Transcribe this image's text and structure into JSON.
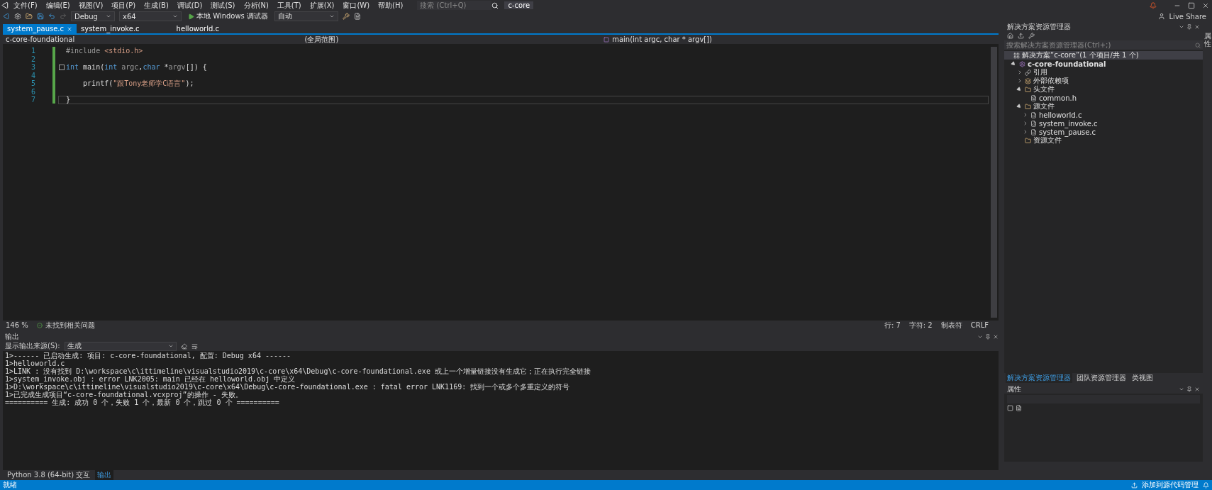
{
  "menu_bar": {
    "items": [
      "文件(F)",
      "编辑(E)",
      "视图(V)",
      "项目(P)",
      "生成(B)",
      "调试(D)",
      "测试(S)",
      "分析(N)",
      "工具(T)",
      "扩展(X)",
      "窗口(W)",
      "帮助(H)"
    ],
    "search": {
      "placeholder": "搜索 (Ctrl+Q)"
    },
    "solution_name": "c-core",
    "live_share": "Live Share"
  },
  "toolbar": {
    "configuration": "Debug",
    "platform": "x64",
    "debugger": "本地 Windows 调试器",
    "mode": "自动"
  },
  "tabs": [
    {
      "label": "system_pause.c",
      "selected": true
    },
    {
      "label": "system_invoke.c",
      "selected": false
    },
    {
      "label": "helloworld.c",
      "selected": false
    }
  ],
  "navigation_bar": {
    "project": "c-core-foundational",
    "scope": "(全局范围)",
    "member": "main(int argc, char * argv[])"
  },
  "editor": {
    "lines": [
      {
        "number": "1",
        "current": false,
        "fold": false,
        "tokens": [
          {
            "text": "#include ",
            "kind": "preprocessor"
          },
          {
            "text": "<stdio.h>",
            "kind": "string"
          }
        ]
      },
      {
        "number": "2",
        "current": false,
        "fold": false
      },
      {
        "number": "3",
        "current": false,
        "fold": true,
        "tokens": [
          {
            "text": "int",
            "kind": "keyword"
          },
          {
            "text": " main(",
            "kind": "plain"
          },
          {
            "text": "int",
            "kind": "keyword"
          },
          {
            "text": " argc",
            "kind": "param"
          },
          {
            "text": ",",
            "kind": "plain"
          },
          {
            "text": "char",
            "kind": "keyword"
          },
          {
            "text": " *",
            "kind": "plain"
          },
          {
            "text": "argv",
            "kind": "param"
          },
          {
            "text": "[]) {",
            "kind": "plain"
          }
        ]
      },
      {
        "number": "4",
        "current": false,
        "fold": false
      },
      {
        "number": "5",
        "current": false,
        "fold": false,
        "tokens": [
          {
            "text": "    printf(",
            "kind": "plain"
          },
          {
            "text": "\"跟Tony老师学C语言\"",
            "kind": "string"
          },
          {
            "text": ");",
            "kind": "plain"
          }
        ]
      },
      {
        "number": "6",
        "current": false,
        "fold": false
      },
      {
        "number": "7",
        "current": true,
        "fold": false,
        "tokens": [
          {
            "text": "}",
            "kind": "plain"
          }
        ]
      }
    ],
    "status": {
      "zoom": "146 %",
      "issues": "未找到相关问题",
      "line": "行: 7",
      "char": "字符: 2",
      "indent": "制表符",
      "eol": "CRLF"
    }
  },
  "output": {
    "title": "输出",
    "source_label": "显示输出来源(S):",
    "source": "生成",
    "lines": [
      "1>------ 已启动生成: 项目: c-core-foundational, 配置: Debug x64 ------",
      "1>helloworld.c",
      "1>LINK : 没有找到 D:\\workspace\\c\\ittimeline\\visualstudio2019\\c-core\\x64\\Debug\\c-core-foundational.exe 或上一个增量链接没有生成它；正在执行完全链接",
      "1>system_invoke.obj : error LNK2005: main 已经在 helloworld.obj 中定义",
      "1>D:\\workspace\\c\\ittimeline\\visualstudio2019\\c-core\\x64\\Debug\\c-core-foundational.exe : fatal error LNK1169: 找到一个或多个多重定义的符号",
      "1>已完成生成项目“c-core-foundational.vcxproj”的操作 - 失败。",
      "========== 生成: 成功 0 个，失败 1 个，最新 0 个，跳过 0 个 =========="
    ]
  },
  "bottom_tabs": [
    {
      "label": "Python 3.8 (64-bit) 交互",
      "selected": false
    },
    {
      "label": "输出",
      "selected": true
    }
  ],
  "solution_explorer": {
    "title": "解决方案资源管理器",
    "search": {
      "placeholder": "搜索解决方案资源管理器(Ctrl+;)"
    },
    "tree": [
      {
        "label": "解决方案“c-core”(1 个项目/共 1 个)",
        "kind": "solution",
        "children": [
          {
            "label": "c-core-foundational",
            "kind": "project",
            "expanded": true,
            "children": [
              {
                "label": "引用",
                "kind": "references",
                "expanded": false
              },
              {
                "label": "外部依赖项",
                "kind": "external",
                "expanded": false
              },
              {
                "label": "头文件",
                "kind": "folder",
                "expanded": true,
                "children": [
                  {
                    "label": "common.h",
                    "kind": "header"
                  }
                ]
              },
              {
                "label": "源文件",
                "kind": "folder",
                "expanded": true,
                "children": [
                  {
                    "label": "helloworld.c",
                    "kind": "source",
                    "expanded": false
                  },
                  {
                    "label": "system_invoke.c",
                    "kind": "source",
                    "expanded": false
                  },
                  {
                    "label": "system_pause.c",
                    "kind": "source",
                    "expanded": false
                  }
                ]
              },
              {
                "label": "资源文件",
                "kind": "folder"
              }
            ]
          }
        ]
      }
    ]
  },
  "right_tabs": [
    {
      "label": "解决方案资源管理器",
      "selected": true
    },
    {
      "label": "团队资源管理器",
      "selected": false
    },
    {
      "label": "类视图",
      "selected": false
    }
  ],
  "properties": {
    "title": "属性"
  },
  "side_strip": {
    "label": "属性"
  },
  "status_bar": {
    "message": "就绪",
    "source_control": "添加到源代码管理"
  }
}
